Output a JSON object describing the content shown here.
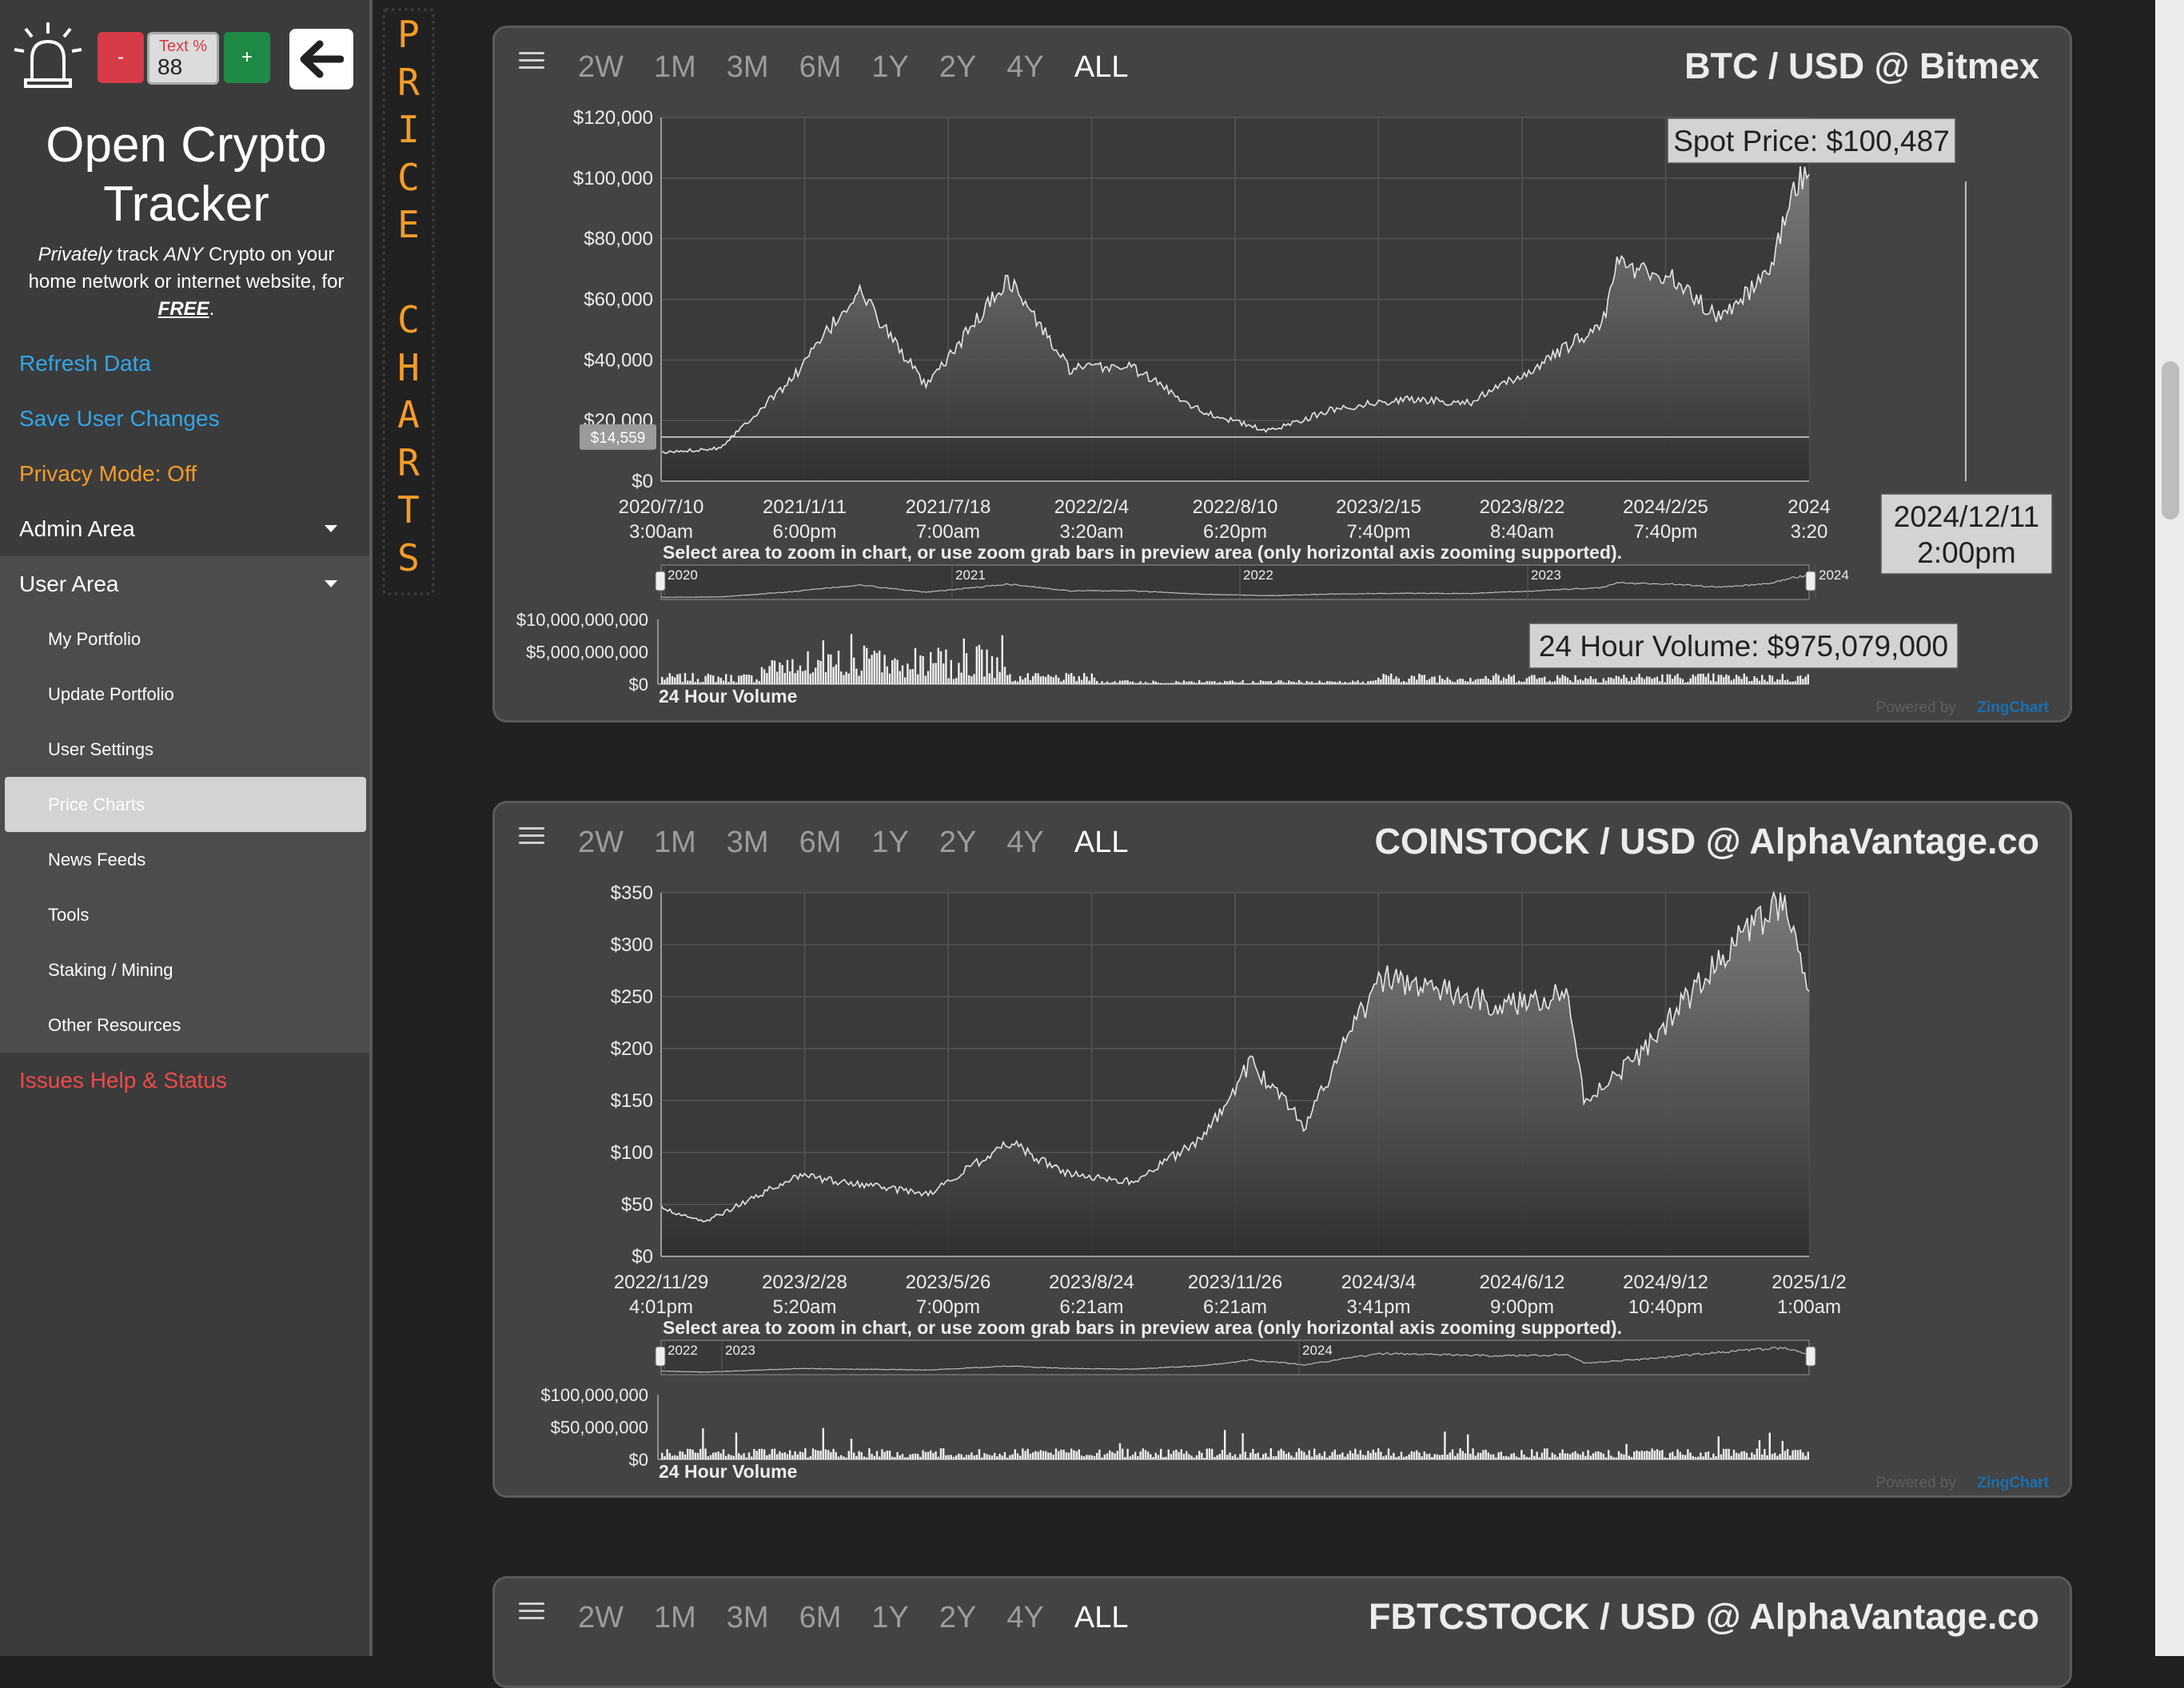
{
  "sidebar": {
    "text_pct_label": "Text %",
    "text_pct_value": "88",
    "minus_label": "-",
    "plus_label": "+",
    "app_title_line1": "Open Crypto",
    "app_title_line2": "Tracker",
    "tagline_word1": "Privately",
    "tagline_part2": " track ",
    "tagline_word2": "ANY",
    "tagline_part3": " Crypto on your home network or internet website, for ",
    "tagline_word3": "FREE",
    "tagline_end": ".",
    "links": {
      "refresh": "Refresh Data",
      "save": "Save User Changes",
      "privacy": "Privacy Mode: Off",
      "admin": "Admin Area",
      "user": "User Area",
      "issues": "Issues Help & Status"
    },
    "user_items": [
      "My Portfolio",
      "Update Portfolio",
      "User Settings",
      "Price Charts",
      "News Feeds",
      "Tools",
      "Staking / Mining",
      "Other Resources"
    ],
    "active_item": "Price Charts",
    "colors": {
      "blue": "#32a6e8",
      "orange": "#f59c28",
      "red": "#ee4a4a"
    }
  },
  "section_label": "PRICE CHARTS",
  "range_buttons": [
    "2W",
    "1M",
    "3M",
    "6M",
    "1Y",
    "2Y",
    "4Y",
    "ALL"
  ],
  "selected_range": "ALL",
  "hint_text": "Select area to zoom in chart, or use zoom grab bars in preview area (only horizontal axis zooming supported).",
  "volume_label": "24 Hour Volume",
  "powered_by": "Powered by",
  "powered_brand": "ZingChart",
  "charts": [
    {
      "title": "BTC / USD @ Bitmex",
      "spot_label": "Spot Price: $100,487",
      "volume_tip": "24 Hour Volume: $975,079,000",
      "date_tip_line1": "2024/12/11",
      "date_tip_line2": "2:00pm",
      "crosshair_value": "$14,559",
      "y_ticks": [
        "$120,000",
        "$100,000",
        "$80,000",
        "$60,000",
        "$40,000",
        "$20,000",
        "$0"
      ],
      "x_ticks": [
        [
          "2020/7/10",
          "3:00am"
        ],
        [
          "2021/1/11",
          "6:00pm"
        ],
        [
          "2021/7/18",
          "7:00am"
        ],
        [
          "2022/2/4",
          "3:20am"
        ],
        [
          "2022/8/10",
          "6:20pm"
        ],
        [
          "2023/2/15",
          "7:40pm"
        ],
        [
          "2023/8/22",
          "8:40am"
        ],
        [
          "2024/2/25",
          "7:40pm"
        ],
        [
          "2024",
          "3:20"
        ]
      ],
      "preview_years": [
        "2020",
        "2021",
        "2022",
        "2023",
        "2024"
      ],
      "vol_ticks": [
        "$10,000,000,000",
        "$5,000,000,000",
        "$0"
      ]
    },
    {
      "title": "COINSTOCK / USD @ AlphaVantage.co",
      "y_ticks": [
        "$350",
        "$300",
        "$250",
        "$200",
        "$150",
        "$100",
        "$50",
        "$0"
      ],
      "x_ticks": [
        [
          "2022/11/29",
          "4:01pm"
        ],
        [
          "2023/2/28",
          "5:20am"
        ],
        [
          "2023/5/26",
          "7:00pm"
        ],
        [
          "2023/8/24",
          "6:21am"
        ],
        [
          "2023/11/26",
          "6:21am"
        ],
        [
          "2024/3/4",
          "3:41pm"
        ],
        [
          "2024/6/12",
          "9:00pm"
        ],
        [
          "2024/9/12",
          "10:40pm"
        ],
        [
          "2025/1/2",
          "1:00am"
        ]
      ],
      "preview_years": [
        "2022",
        "2023",
        "2024"
      ],
      "vol_ticks": [
        "$100,000,000",
        "$50,000,000",
        "$0"
      ]
    },
    {
      "title": "FBTCSTOCK / USD @ AlphaVantage.co"
    }
  ],
  "chart_data": [
    {
      "type": "area",
      "title": "BTC / USD @ Bitmex",
      "ylim": [
        0,
        120000
      ],
      "x": [
        "2020/7/10",
        "2020/10/1",
        "2021/1/11",
        "2021/4/14",
        "2021/7/18",
        "2021/11/10",
        "2022/2/4",
        "2022/5/1",
        "2022/8/10",
        "2022/11/10",
        "2023/2/15",
        "2023/5/20",
        "2023/8/22",
        "2023/11/20",
        "2024/2/25",
        "2024/3/14",
        "2024/6/1",
        "2024/8/5",
        "2024/10/15",
        "2024/11/20",
        "2024/12/11"
      ],
      "y": [
        9300,
        11000,
        34000,
        63000,
        31000,
        67000,
        37000,
        38000,
        23000,
        16500,
        24000,
        27000,
        26000,
        37000,
        52000,
        72000,
        67000,
        54000,
        68000,
        98000,
        100487
      ]
    },
    {
      "type": "area",
      "title": "COINSTOCK / USD @ AlphaVantage.co",
      "ylim": [
        0,
        350
      ],
      "x": [
        "2022/11/29",
        "2022/12/28",
        "2023/2/28",
        "2023/5/26",
        "2023/7/20",
        "2023/8/24",
        "2023/10/10",
        "2023/11/26",
        "2023/12/27",
        "2024/2/1",
        "2024/3/4",
        "2024/3/25",
        "2024/6/12",
        "2024/7/25",
        "2024/8/5",
        "2024/9/12",
        "2024/11/12",
        "2024/12/15",
        "2025/1/2"
      ],
      "y": [
        47,
        33,
        78,
        60,
        110,
        80,
        72,
        115,
        187,
        125,
        220,
        270,
        240,
        255,
        150,
        195,
        300,
        342,
        255
      ]
    }
  ]
}
